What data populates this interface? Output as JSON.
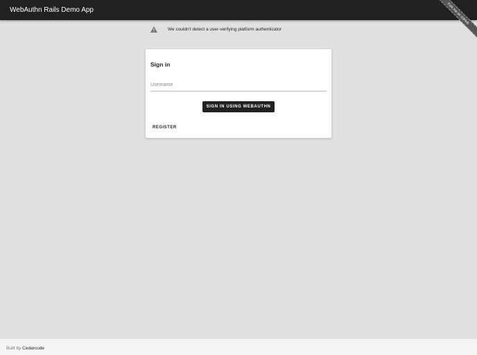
{
  "header": {
    "title": "WebAuthn Rails Demo App",
    "ribbon": "Fork me on GitHub"
  },
  "alert": {
    "icon": "warning-icon",
    "text": "We couldn't detect a user-verifying platform authenticator"
  },
  "signin": {
    "title": "Sign in",
    "username_placeholder": "Username",
    "username_value": "",
    "submit_label": "SIGN IN USING WEBAUTHN",
    "register_label": "REGISTER"
  },
  "footer": {
    "prefix": "Built by",
    "link": "Cedarcode"
  }
}
